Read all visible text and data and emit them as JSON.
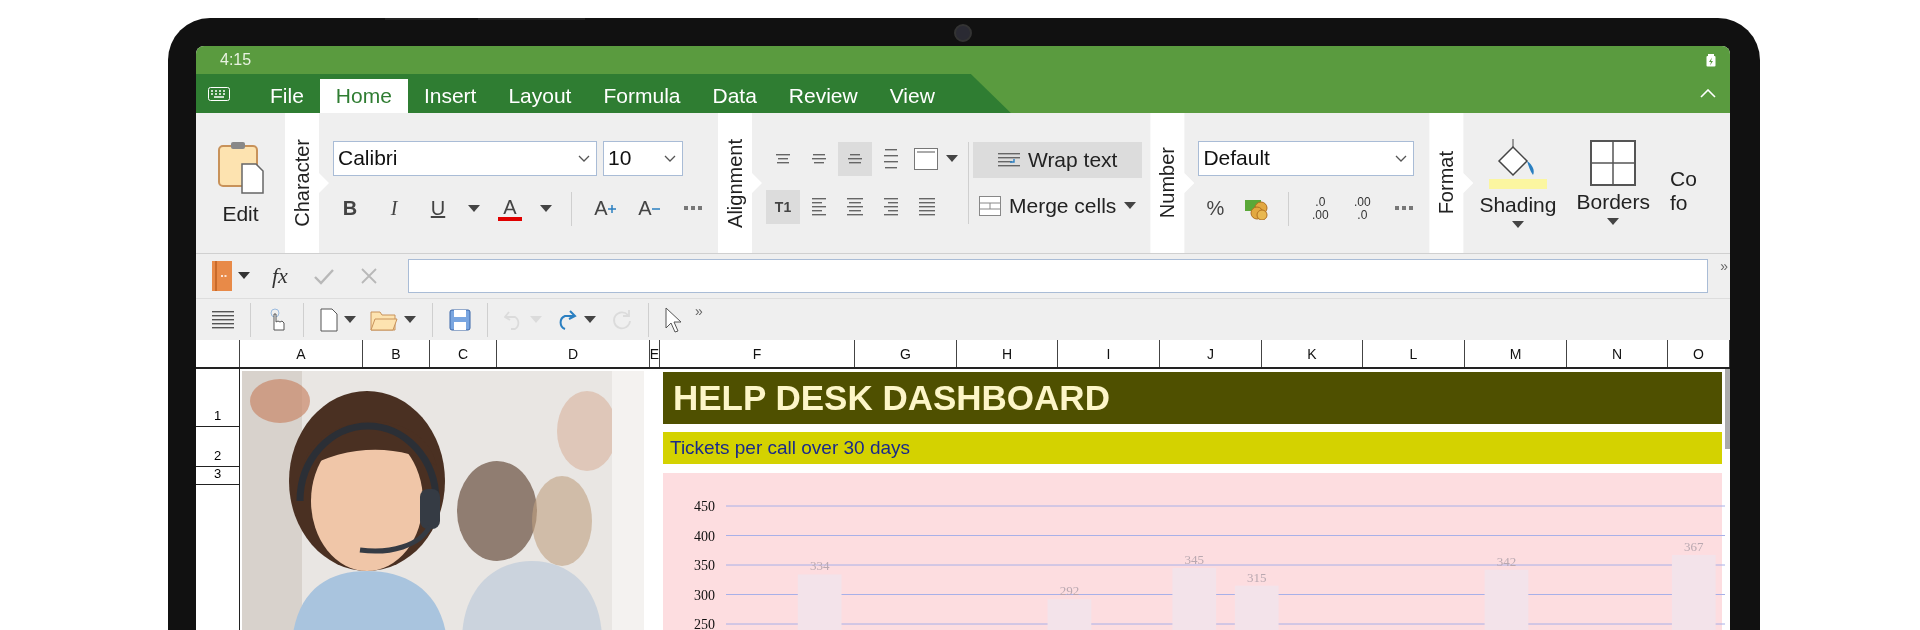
{
  "status_bar": {
    "time": "4:15"
  },
  "tabs": [
    {
      "label": "File",
      "selected": false
    },
    {
      "label": "Home",
      "selected": true
    },
    {
      "label": "Insert",
      "selected": false
    },
    {
      "label": "Layout",
      "selected": false
    },
    {
      "label": "Formula",
      "selected": false
    },
    {
      "label": "Data",
      "selected": false
    },
    {
      "label": "Review",
      "selected": false
    },
    {
      "label": "View",
      "selected": false
    }
  ],
  "ribbon": {
    "edit": {
      "label": "Edit"
    },
    "character": {
      "title": "Character",
      "font": "Calibri",
      "size": "10",
      "tools": [
        {
          "kind": "bold",
          "label": "B"
        },
        {
          "kind": "italic",
          "label": "I"
        },
        {
          "kind": "underline",
          "label": "U"
        },
        {
          "kind": "caret"
        },
        {
          "kind": "font_color",
          "label": "A"
        },
        {
          "kind": "caret"
        },
        {
          "kind": "grow",
          "label": "A"
        },
        {
          "kind": "shrink",
          "label": "A"
        },
        {
          "kind": "more"
        }
      ]
    },
    "alignment": {
      "title": "Alignment",
      "vertical": [
        {
          "kind": "top",
          "selected": false
        },
        {
          "kind": "middle",
          "selected": false
        },
        {
          "kind": "bottom",
          "selected": true
        },
        {
          "kind": "distributed",
          "selected": false
        }
      ],
      "horizontal": [
        {
          "kind": "direction",
          "label": "T1",
          "selected": true
        },
        {
          "kind": "left",
          "selected": false
        },
        {
          "kind": "center",
          "selected": false
        },
        {
          "kind": "right",
          "selected": false
        },
        {
          "kind": "justify",
          "selected": false
        }
      ],
      "wrap": {
        "label": "Wrap text",
        "selected": true
      },
      "merge": {
        "label": "Merge cells",
        "selected": false
      }
    },
    "number": {
      "title": "Number",
      "format": "Default",
      "tools": [
        {
          "kind": "percent",
          "label": "%"
        },
        {
          "kind": "currency"
        },
        {
          "kind": "add_decimal",
          "top": ".0",
          "bottom": ".00"
        },
        {
          "kind": "remove_decimal",
          "top": ".00",
          "bottom": ".0"
        },
        {
          "kind": "more"
        }
      ]
    },
    "format": {
      "title": "Format",
      "buttons": [
        {
          "kind": "shading",
          "label": "Shading"
        },
        {
          "kind": "borders",
          "label": "Borders"
        },
        {
          "kind": "conditional",
          "label": "Co\nfo"
        }
      ]
    }
  },
  "formula_bar": {
    "function_label": "fx",
    "actions": [
      {
        "kind": "accept",
        "disabled": true
      },
      {
        "kind": "cancel",
        "disabled": true
      }
    ],
    "overflow": "»"
  },
  "toolbar": {
    "items": [
      {
        "kind": "menu",
        "disabled": false,
        "dropdown": false
      },
      {
        "kind": "touch",
        "disabled": false,
        "dropdown": false
      },
      {
        "kind": "new",
        "disabled": false,
        "dropdown": true
      },
      {
        "kind": "open",
        "disabled": false,
        "dropdown": true
      },
      {
        "kind": "save",
        "disabled": false,
        "dropdown": false
      },
      {
        "kind": "undo",
        "disabled": true,
        "dropdown": true
      },
      {
        "kind": "redo",
        "disabled": false,
        "dropdown": true
      },
      {
        "kind": "repeat",
        "disabled": true,
        "dropdown": false
      },
      {
        "kind": "select",
        "disabled": false,
        "dropdown": false
      }
    ],
    "overflow": "»"
  },
  "sheet": {
    "columns": [
      "A",
      "B",
      "C",
      "D",
      "E",
      "F",
      "G",
      "H",
      "I",
      "J",
      "K",
      "L",
      "M",
      "N",
      "O"
    ],
    "rows": [
      "1",
      "2",
      "3"
    ],
    "photo": {
      "kind": "picture"
    },
    "title": "HELP DESK DASHBOARD",
    "subtitle": "Tickets per call over 30 days",
    "chart": {
      "chart_data": {
        "type": "bar",
        "values": [
          null,
          334,
          null,
          null,
          null,
          292,
          null,
          345,
          315,
          null,
          null,
          null,
          342,
          null,
          null,
          367
        ],
        "ylim": [
          250,
          450
        ],
        "yticks": [
          250,
          300,
          350,
          400,
          450
        ],
        "grid": true,
        "data_labels": true
      }
    }
  }
}
